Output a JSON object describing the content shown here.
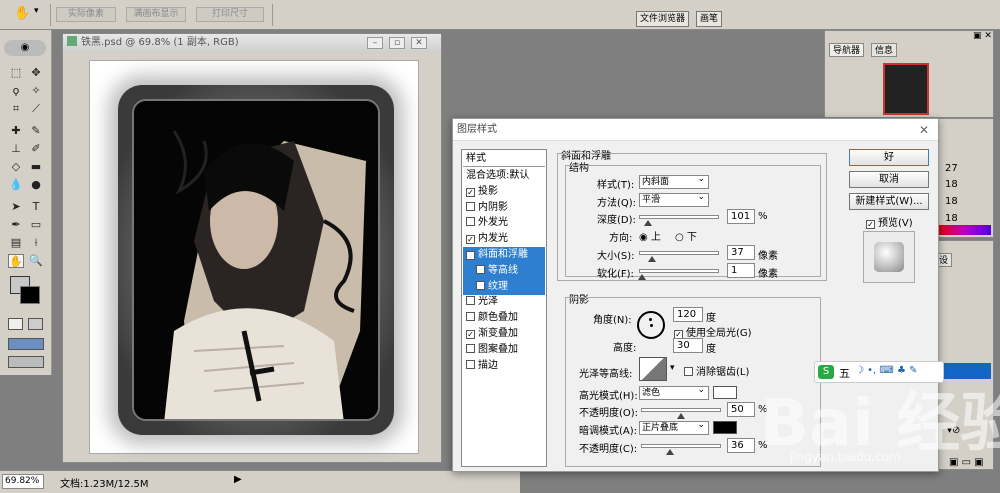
{
  "options_bar": {
    "buttons": [
      "实际像素",
      "满画布显示",
      "打印尺寸"
    ],
    "dock_tabs": [
      "文件浏览器",
      "画笔"
    ]
  },
  "document": {
    "title": "铁黑.psd @ 69.8% (1 副本, RGB)",
    "zoom": "69.82%",
    "doc_size": "文档:1.23M/12.5M"
  },
  "dialog": {
    "title": "图层样式",
    "style_header": "样式",
    "styles": [
      {
        "label": "混合选项:默认",
        "checkbox": false,
        "checked": false,
        "selected": false,
        "indent": false
      },
      {
        "label": "投影",
        "checkbox": true,
        "checked": true,
        "selected": false,
        "indent": false
      },
      {
        "label": "内阴影",
        "checkbox": true,
        "checked": false,
        "selected": false,
        "indent": false
      },
      {
        "label": "外发光",
        "checkbox": true,
        "checked": false,
        "selected": false,
        "indent": false
      },
      {
        "label": "内发光",
        "checkbox": true,
        "checked": true,
        "selected": false,
        "indent": false
      },
      {
        "label": "斜面和浮雕",
        "checkbox": true,
        "checked": true,
        "selected": true,
        "indent": false
      },
      {
        "label": "等高线",
        "checkbox": true,
        "checked": false,
        "selected": true,
        "indent": true
      },
      {
        "label": "纹理",
        "checkbox": true,
        "checked": false,
        "selected": true,
        "indent": true
      },
      {
        "label": "光泽",
        "checkbox": true,
        "checked": false,
        "selected": false,
        "indent": false
      },
      {
        "label": "颜色叠加",
        "checkbox": true,
        "checked": false,
        "selected": false,
        "indent": false
      },
      {
        "label": "渐变叠加",
        "checkbox": true,
        "checked": true,
        "selected": false,
        "indent": false
      },
      {
        "label": "图案叠加",
        "checkbox": true,
        "checked": false,
        "selected": false,
        "indent": false
      },
      {
        "label": "描边",
        "checkbox": true,
        "checked": false,
        "selected": false,
        "indent": false
      }
    ],
    "bevel": {
      "group_title": "斜面和浮雕",
      "structure_title": "结构",
      "style_label": "样式(T):",
      "style_value": "内斜面",
      "technique_label": "方法(Q):",
      "technique_value": "平滑",
      "depth_label": "深度(D):",
      "depth_value": "101",
      "depth_unit": "%",
      "depth_fraction": 0.1,
      "direction_label": "方向:",
      "direction_up": "上",
      "direction_down": "下",
      "size_label": "大小(S):",
      "size_value": "37",
      "size_unit": "像素",
      "size_fraction": 0.15,
      "soften_label": "软化(F):",
      "soften_value": "1",
      "soften_unit": "像素",
      "soften_fraction": 0.02
    },
    "shading": {
      "title": "阴影",
      "angle_label": "角度(N):",
      "angle_value": "120",
      "angle_unit": "度",
      "global_light_label": "使用全局光(G)",
      "altitude_label": "高度:",
      "altitude_value": "30",
      "altitude_unit": "度",
      "gloss_label": "光泽等高线:",
      "antialias_label": "消除锯齿(L)",
      "highlight_mode_label": "高光模式(H):",
      "highlight_mode_value": "滤色",
      "highlight_color": "#ffffff",
      "highlight_opacity_label": "不透明度(O):",
      "highlight_opacity_value": "50",
      "highlight_opacity_unit": "%",
      "highlight_opacity_fraction": 0.5,
      "shadow_mode_label": "暗调模式(A):",
      "shadow_mode_value": "正片叠底",
      "shadow_color": "#000000",
      "shadow_opacity_label": "不透明度(C):",
      "shadow_opacity_value": "36",
      "shadow_opacity_unit": "%",
      "shadow_opacity_fraction": 0.36
    },
    "buttons": {
      "ok": "好",
      "cancel": "取消",
      "new_style": "新建样式(W)...",
      "preview": "预览(V)"
    }
  },
  "panels": {
    "navigator_tabs": [
      "导航器",
      "信息"
    ],
    "info_values": [
      "27",
      "18",
      "18",
      "18"
    ],
    "layers_tab": "设"
  },
  "watermark": {
    "brand": "Bai  经验",
    "url": "jingyan.baidu.com"
  },
  "ime_label": "五"
}
